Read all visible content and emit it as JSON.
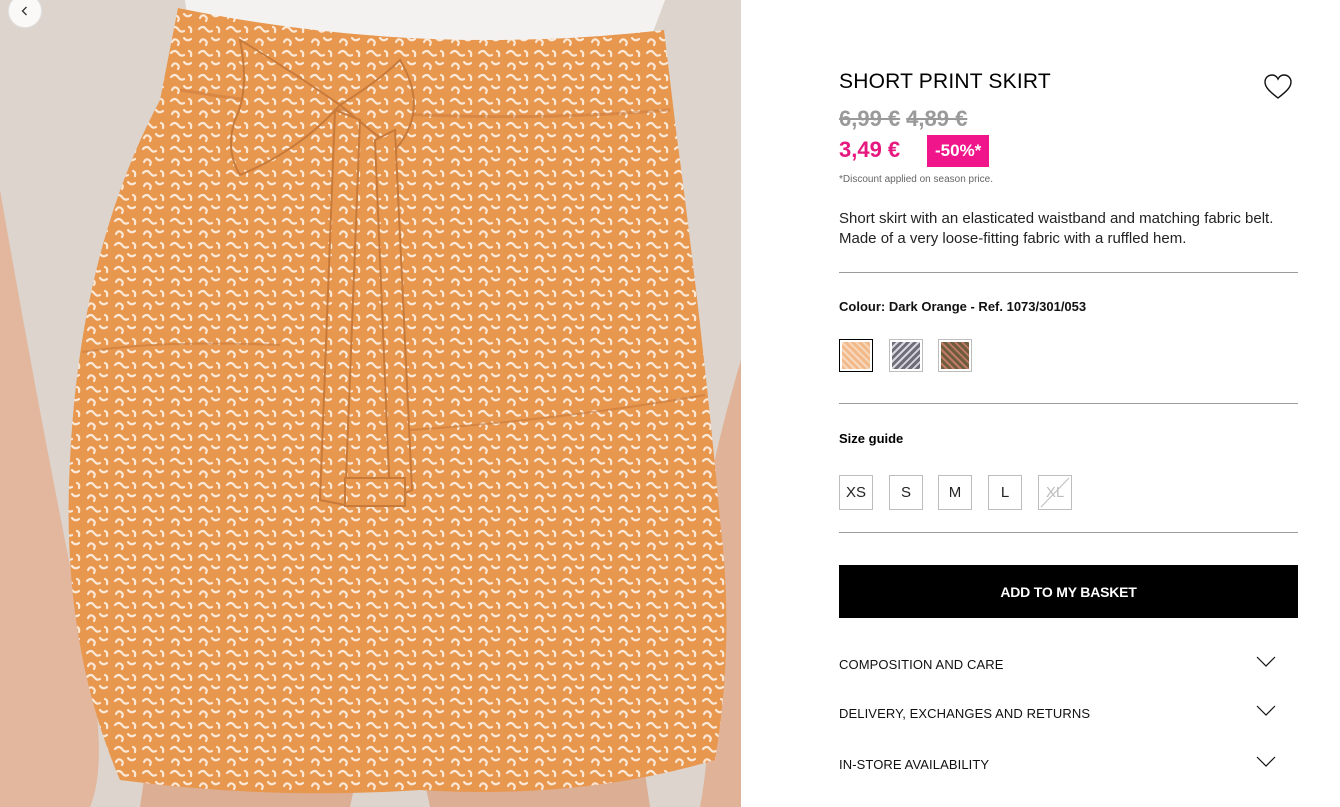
{
  "product": {
    "title": "SHORT PRINT SKIRT",
    "old_price_1": "6,99 €",
    "old_price_2": "4,89 €",
    "current_price": "3,49 €",
    "discount_badge": "-50%*",
    "discount_note": "*Discount applied on season price.",
    "description": "Short skirt with an elasticated waistband and matching fabric belt. Made of a very loose-fitting fabric with a ruffled hem."
  },
  "colour": {
    "label": "Colour:",
    "value": "Dark Orange - Ref. 1073/301/053",
    "swatches": [
      {
        "name": "dark-orange",
        "color": "#f2b98a",
        "selected": true
      },
      {
        "name": "grey-print",
        "color": "#8c8a96",
        "selected": false
      },
      {
        "name": "green-print",
        "color": "#7a6a48",
        "selected": false
      }
    ]
  },
  "sizes": {
    "guide_label": "Size guide",
    "options": [
      {
        "label": "XS",
        "available": true
      },
      {
        "label": "S",
        "available": true
      },
      {
        "label": "M",
        "available": true
      },
      {
        "label": "L",
        "available": true
      },
      {
        "label": "XL",
        "available": false
      }
    ]
  },
  "actions": {
    "add_to_basket": "ADD TO MY BASKET"
  },
  "accordions": [
    {
      "label": "COMPOSITION AND CARE"
    },
    {
      "label": "DELIVERY, EXCHANGES AND RETURNS"
    },
    {
      "label": "IN-STORE AVAILABILITY"
    }
  ],
  "theme": {
    "price_color": "#e6177f",
    "badge_color": "#f0158a",
    "button_color": "#000000"
  },
  "icons": {
    "back": "chevron-left-icon",
    "wishlist": "heart-outline-icon",
    "expand": "chevron-down-icon"
  }
}
